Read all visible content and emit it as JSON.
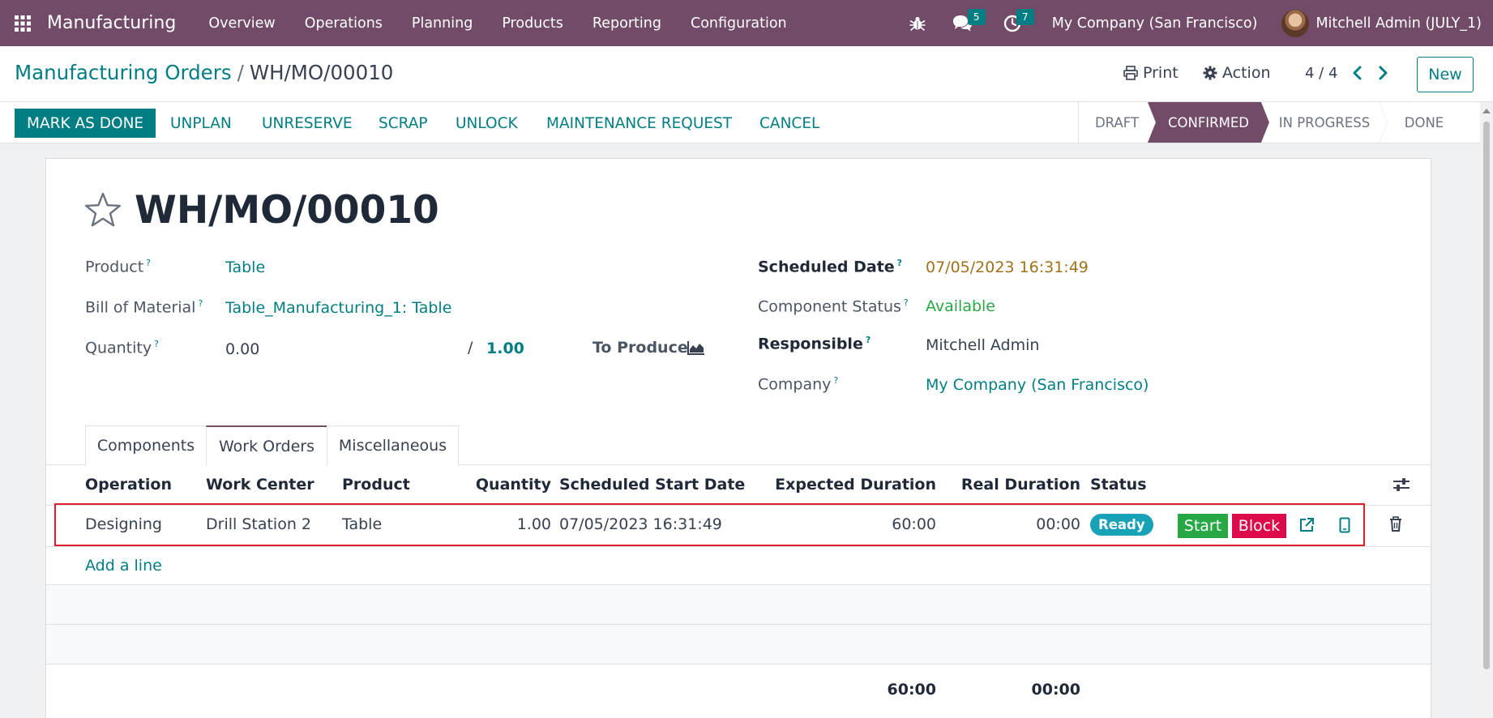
{
  "navbar": {
    "app_title": "Manufacturing",
    "menu": [
      "Overview",
      "Operations",
      "Planning",
      "Products",
      "Reporting",
      "Configuration"
    ],
    "messages_count": "5",
    "activities_count": "7",
    "company": "My Company (San Francisco)",
    "user": "Mitchell Admin (JULY_1)"
  },
  "control_panel": {
    "breadcrumb_parent": "Manufacturing Orders",
    "breadcrumb_separator": "/",
    "breadcrumb_current": "WH/MO/00010",
    "print_label": "Print",
    "action_label": "Action",
    "pager": "4 / 4",
    "new_label": "New"
  },
  "action_bar": {
    "primary": "MARK AS DONE",
    "buttons": [
      "UNPLAN",
      "UNRESERVE",
      "SCRAP",
      "UNLOCK",
      "MAINTENANCE REQUEST",
      "CANCEL"
    ],
    "stages": [
      "DRAFT",
      "CONFIRMED",
      "IN PROGRESS",
      "DONE"
    ],
    "active_stage": "CONFIRMED"
  },
  "form": {
    "title": "WH/MO/00010",
    "product_label": "Product",
    "product_value": "Table",
    "bom_label": "Bill of Material",
    "bom_value": "Table_Manufacturing_1: Table",
    "quantity_label": "Quantity",
    "quantity_produced": "0.00",
    "quantity_separator": "/",
    "quantity_total": "1.00",
    "to_produce_label": "To Produce",
    "scheduled_label": "Scheduled Date",
    "scheduled_value": "07/05/2023 16:31:49",
    "component_status_label": "Component Status",
    "component_status_value": "Available",
    "responsible_label": "Responsible",
    "responsible_value": "Mitchell Admin",
    "company_label": "Company",
    "company_value": "My Company (San Francisco)",
    "help_marker": "?"
  },
  "tabs": [
    "Components",
    "Work Orders",
    "Miscellaneous"
  ],
  "active_tab": "Work Orders",
  "work_orders": {
    "columns": [
      "Operation",
      "Work Center",
      "Product",
      "Quantity",
      "Scheduled Start Date",
      "Expected Duration",
      "Real Duration",
      "Status"
    ],
    "rows": [
      {
        "operation": "Designing",
        "work_center": "Drill Station 2",
        "product": "Table",
        "quantity": "1.00",
        "scheduled_start": "07/05/2023 16:31:49",
        "expected_duration": "60:00",
        "real_duration": "00:00",
        "status": "Ready",
        "start_label": "Start",
        "block_label": "Block"
      }
    ],
    "add_line": "Add a line",
    "total_expected": "60:00",
    "total_real": "00:00"
  },
  "colors": {
    "brand": "#714b67",
    "accent": "#017e84",
    "start": "#28a745",
    "block": "#dc0a4a",
    "ready": "#17a2b8",
    "highlight": "#e11d2e"
  },
  "icons": [
    "apps-grid-icon",
    "bug-icon",
    "chat-icon",
    "clock-icon",
    "print-icon",
    "gear-icon",
    "chevron-left-icon",
    "chevron-right-icon",
    "star-icon",
    "area-chart-icon",
    "settings-sliders-icon",
    "external-link-icon",
    "tablet-icon",
    "trash-icon"
  ]
}
